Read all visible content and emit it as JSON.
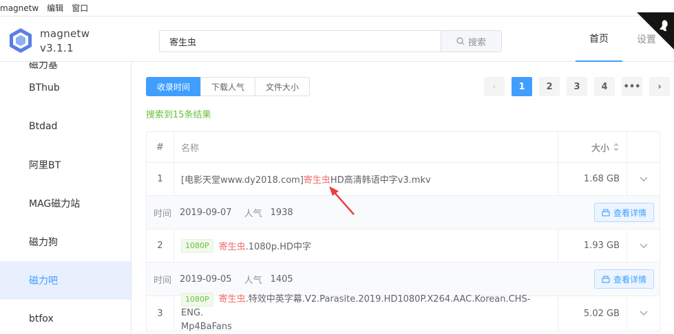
{
  "menu": {
    "items": [
      "magnetw",
      "编辑",
      "窗口"
    ]
  },
  "app": {
    "name": "magnetw",
    "version": "v3.1.1"
  },
  "search": {
    "value": "寄生虫",
    "button_label": "搜索"
  },
  "nav": {
    "home": "首页",
    "settings": "设置"
  },
  "sidebar": {
    "items": [
      {
        "label": "磁力基"
      },
      {
        "label": "BThub"
      },
      {
        "label": "Btdad"
      },
      {
        "label": "阿里BT"
      },
      {
        "label": "MAG磁力站"
      },
      {
        "label": "磁力狗"
      },
      {
        "label": "磁力吧"
      },
      {
        "label": "btfox"
      }
    ],
    "active": "磁力吧"
  },
  "sort": {
    "tabs": [
      "收录时间",
      "下载人气",
      "文件大小"
    ],
    "active": "收录时间"
  },
  "pager": {
    "prev": "‹",
    "pages": [
      "1",
      "2",
      "3",
      "4"
    ],
    "more": "•••",
    "next": "›",
    "current": "1"
  },
  "result_count": "搜索到15条结果",
  "table": {
    "headers": {
      "index": "#",
      "name": "名称",
      "size": "大小"
    },
    "rows": [
      {
        "index": "1",
        "tag": "",
        "name_prefix": "[电影天堂www.dy2018.com]",
        "name_highlight": "寄生虫",
        "name_suffix": "HD高清韩语中字v3.mkv",
        "size": "1.68 GB",
        "time_label": "时间",
        "time": "2019-09-07",
        "popularity_label": "人气",
        "popularity": "1938",
        "detail_button": "查看详情"
      },
      {
        "index": "2",
        "tag": "1080P",
        "name_prefix": "",
        "name_highlight": "寄生虫",
        "name_suffix": ".1080p.HD中字",
        "size": "1.93 GB",
        "time_label": "时间",
        "time": "2019-09-05",
        "popularity_label": "人气",
        "popularity": "1405",
        "detail_button": "查看详情"
      },
      {
        "index": "3",
        "tag": "1080P",
        "name_prefix": "",
        "name_highlight": "寄生虫",
        "name_suffix": ".特效中英字幕.V2.Parasite.2019.HD1080P.X264.AAC.Korean.CHS-ENG.",
        "name_suffix2": "Mp4BaFans",
        "size": "5.02 GB"
      }
    ]
  },
  "colors": {
    "accent": "#409eff",
    "highlight": "#f56c6c",
    "success": "#67c23a",
    "annotation_arrow": "#e8413b"
  }
}
